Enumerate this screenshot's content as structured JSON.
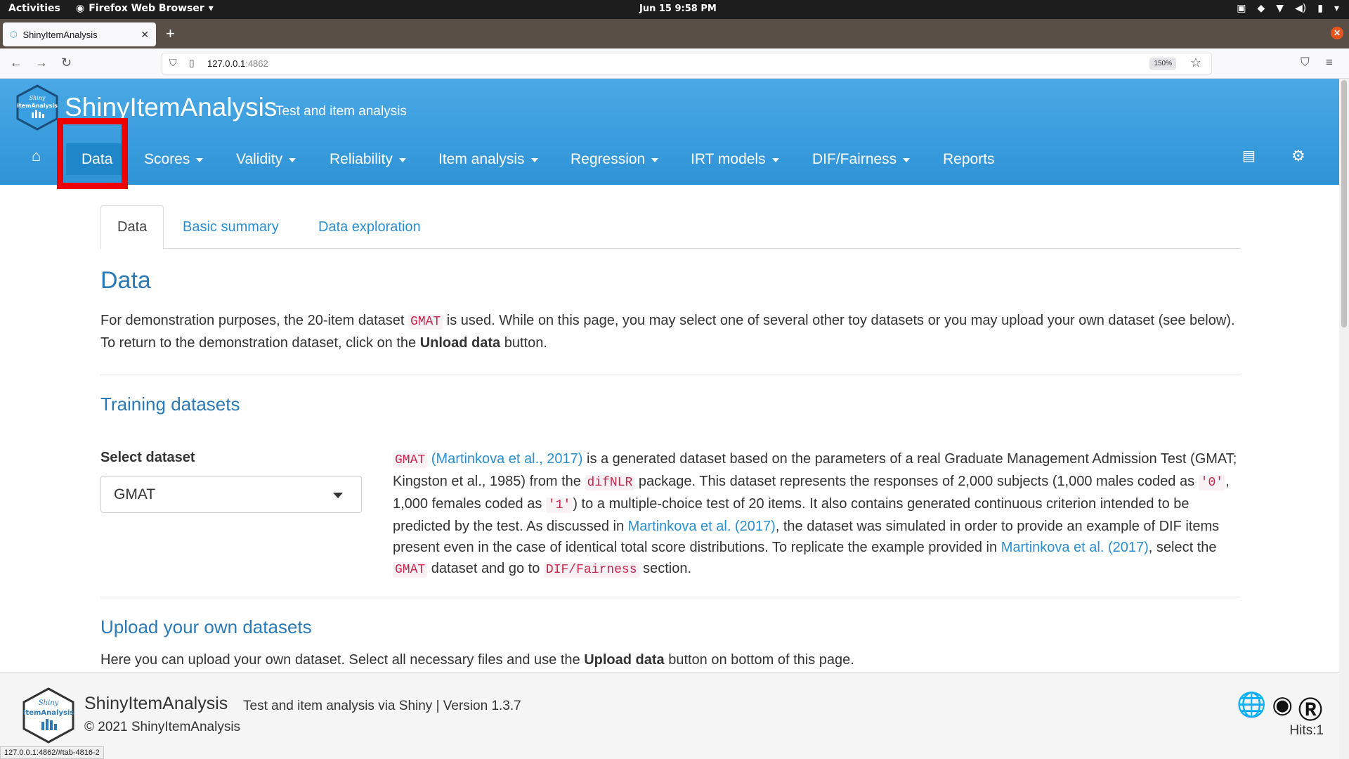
{
  "system": {
    "activities": "Activities",
    "app_name": "Firefox Web Browser",
    "clock": "Jun 15  9:58 PM"
  },
  "browser": {
    "tab_title": "ShinyItemAnalysis",
    "new_tab": "+",
    "url_host": "127.0.0.1",
    "url_port": ":4862",
    "zoom": "150%",
    "status_url": "127.0.0.1:4862/#tab-4816-2"
  },
  "header": {
    "title": "ShinyItemAnalysis",
    "subtitle": "Test and item analysis",
    "logo_text_top": "Shiny",
    "logo_text_main": "ItemAnalysis"
  },
  "menu": {
    "items": [
      {
        "label": "Data",
        "active": true,
        "dropdown": false
      },
      {
        "label": "Scores",
        "dropdown": true
      },
      {
        "label": "Validity",
        "dropdown": true
      },
      {
        "label": "Reliability",
        "dropdown": true
      },
      {
        "label": "Item analysis",
        "dropdown": true
      },
      {
        "label": "Regression",
        "dropdown": true
      },
      {
        "label": "IRT models",
        "dropdown": true
      },
      {
        "label": "DIF/Fairness",
        "dropdown": true
      },
      {
        "label": "Reports",
        "dropdown": false
      }
    ]
  },
  "page_tabs": [
    "Data",
    "Basic summary",
    "Data exploration"
  ],
  "main": {
    "title": "Data",
    "intro_1": "For demonstration purposes, the 20-item dataset ",
    "intro_code": "GMAT",
    "intro_2": " is used. While on this page, you may select one of several other toy datasets or you may upload your own dataset (see below). To return to the demonstration dataset, click on the ",
    "intro_bold": "Unload data",
    "intro_3": " button.",
    "training_heading": "Training datasets",
    "select_label": "Select dataset",
    "select_value": "GMAT",
    "desc": {
      "code1": "GMAT",
      "link1": "(Martinkova et al., 2017)",
      "t1": " is a generated dataset based on the parameters of a real Graduate Management Admission Test (GMAT; Kingston et al., 1985) from the ",
      "code2": "difNLR",
      "t2": " package. This dataset represents the responses of 2,000 subjects (1,000 males coded as ",
      "code3": "'0'",
      "t3": ", 1,000 females coded as ",
      "code4": "'1'",
      "t4": ") to a multiple-choice test of 20 items. It also contains generated continuous criterion intended to be predicted by the test. As discussed in ",
      "link2": "Martinkova et al. (2017)",
      "t5": ", the dataset was simulated in order to provide an example of DIF items present even in the case of identical total score distributions. To replicate the example provided in ",
      "link3": "Martinkova et al. (2017)",
      "t6": ", select the ",
      "code5": "GMAT",
      "t7": " dataset and go to ",
      "code6": "DIF/Fairness",
      "t8": " section."
    },
    "upload_heading": "Upload your own datasets",
    "upload_1": "Here you can upload your own dataset. Select all necessary files and use the ",
    "upload_bold": "Upload data",
    "upload_2": " button on bottom of this page."
  },
  "footer": {
    "title": "ShinyItemAnalysis",
    "subtitle": "Test and item analysis via Shiny | Version 1.3.7",
    "copyright": "© 2021 ShinyItemAnalysis",
    "hits": "Hits:1"
  },
  "colors": {
    "header": "#3a9fe0",
    "active_tab": "#1f86c9",
    "highlight": "#ee0000",
    "link": "#2a8fd0"
  }
}
